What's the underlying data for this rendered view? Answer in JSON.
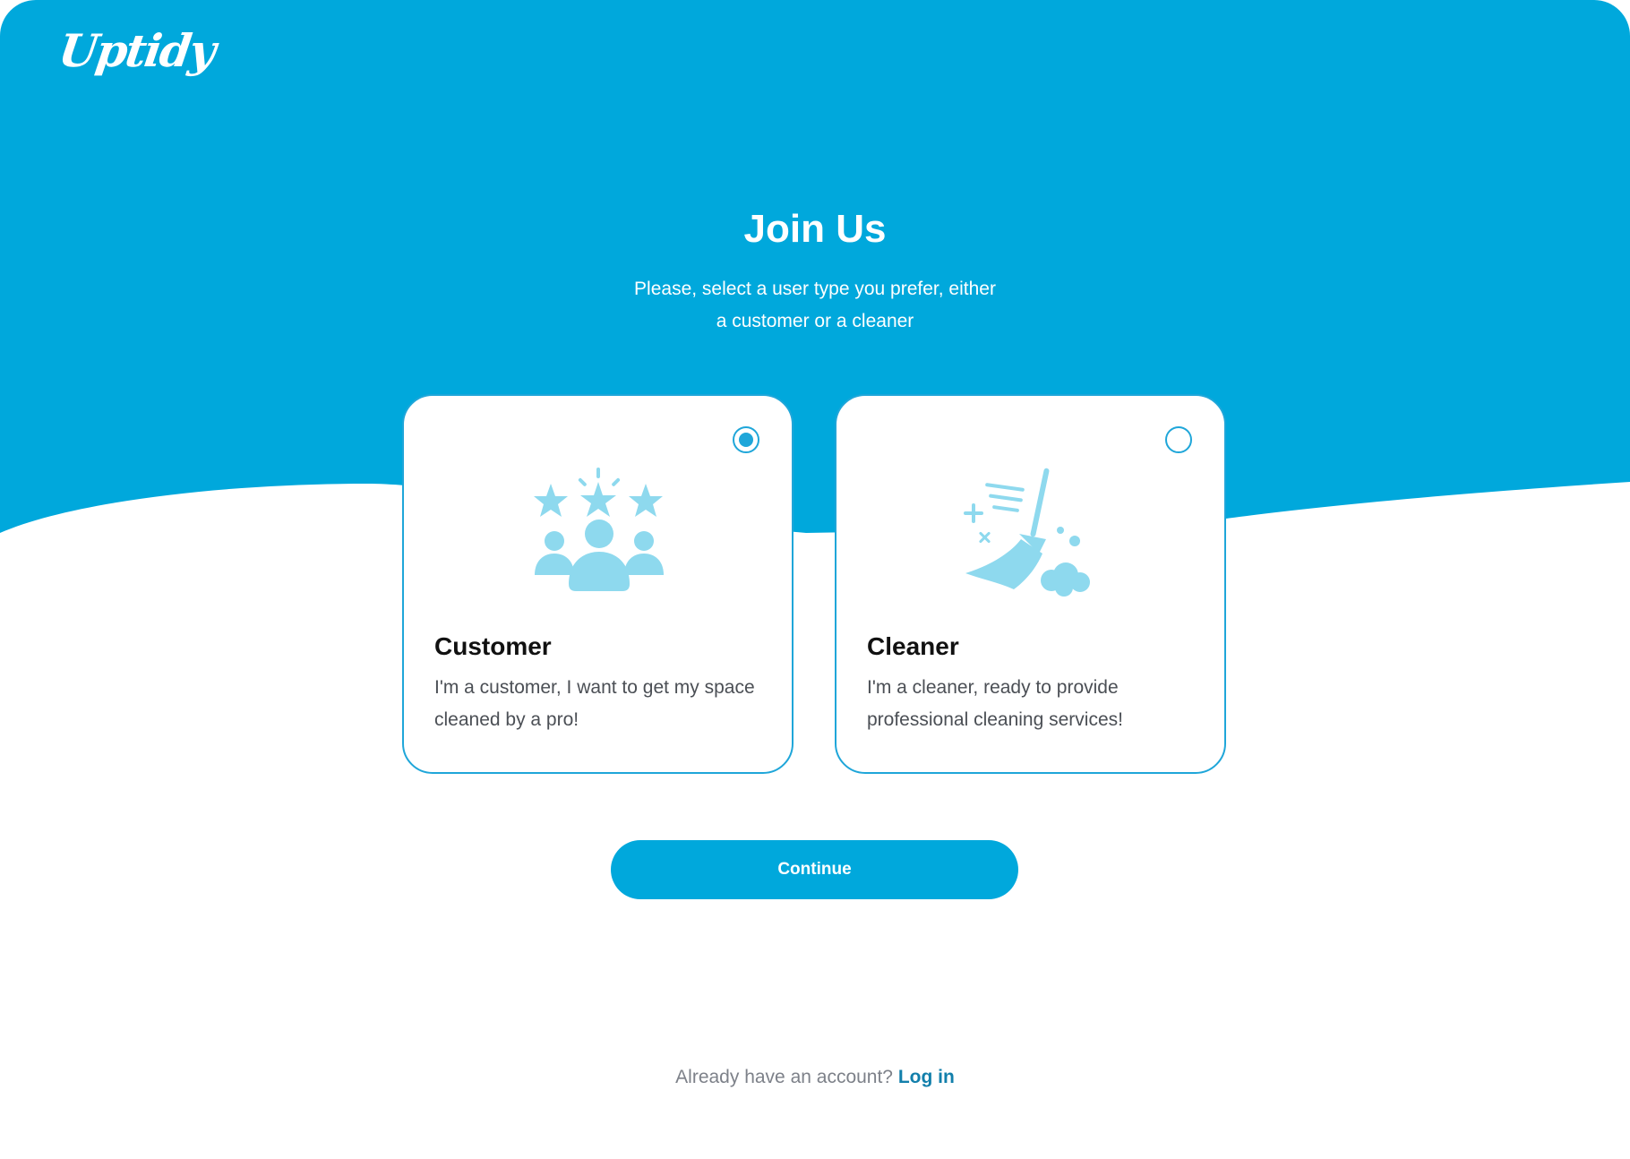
{
  "brand": {
    "logo_text": "Uptidy",
    "primary_color": "#00a8dc",
    "icon_color": "#8ed9ee"
  },
  "header": {
    "title": "Join Us",
    "subtitle_line1": "Please, select a user type you prefer, either",
    "subtitle_line2": "a customer or a cleaner"
  },
  "options": [
    {
      "title": "Customer",
      "description": "I'm a customer, I want to get my space cleaned by a pro!",
      "selected": true,
      "icon": "people-rating-icon"
    },
    {
      "title": "Cleaner",
      "description": "I'm a cleaner, ready to provide professional cleaning services!",
      "selected": false,
      "icon": "broom-icon"
    }
  ],
  "actions": {
    "continue_label": "Continue"
  },
  "footer": {
    "prompt": "Already have an account?",
    "login_label": "Log in"
  }
}
